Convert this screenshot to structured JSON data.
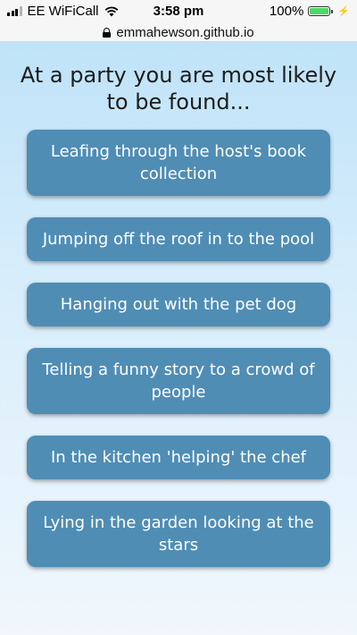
{
  "status_bar": {
    "carrier": "EE WiFiCall",
    "time": "3:58 pm",
    "battery_percent": "100%",
    "battery_level": 1.0,
    "icons": [
      "signal-icon",
      "wifi-icon",
      "battery-icon",
      "charging-bolt-icon"
    ]
  },
  "browser": {
    "url": "emmahewson.github.io",
    "icons": [
      "lock-icon"
    ]
  },
  "quiz": {
    "question": "At a party you are most likely to be found...",
    "answers": [
      "Leafing through the host's book collection",
      "Jumping off the roof in to the pool",
      "Hanging out with the pet dog",
      "Telling a funny story to a crowd of people",
      "In the kitchen 'helping' the chef",
      "Lying in the garden looking at the stars"
    ]
  },
  "colors": {
    "button_background": "#4f8db5",
    "button_text": "#ffffff",
    "background_top": "#bfe3f8",
    "background_bottom": "#f1f7fc",
    "battery_fill": "#4cd964"
  }
}
